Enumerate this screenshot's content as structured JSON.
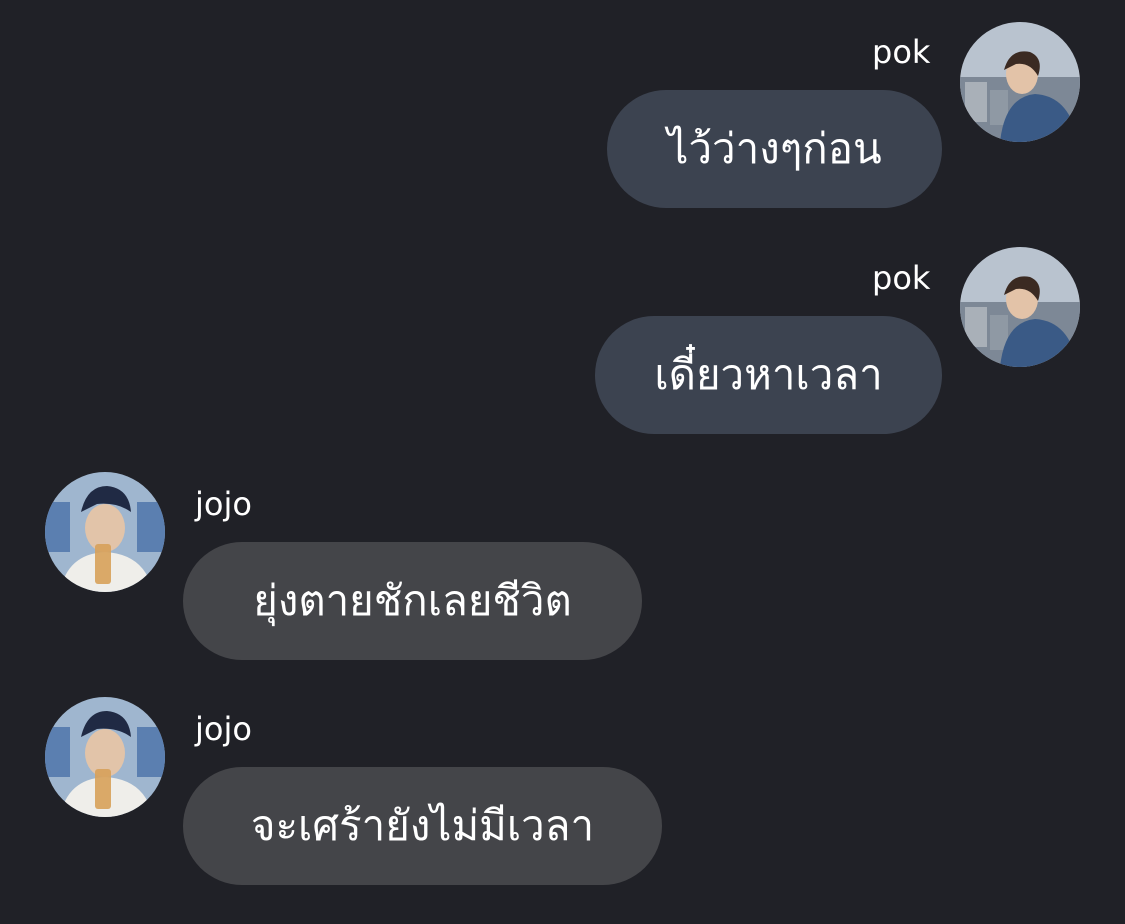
{
  "messages": [
    {
      "sender": "pok",
      "text": "ไว้ว่างๆก่อน",
      "direction": "outgoing",
      "avatar": "user-photo"
    },
    {
      "sender": "pok",
      "text": "เดี๋ยวหาเวลา",
      "direction": "outgoing",
      "avatar": "user-photo"
    },
    {
      "sender": "jojo",
      "text": "ยุ่งตายชักเลยชีวิต",
      "direction": "incoming",
      "avatar": "user-photo"
    },
    {
      "sender": "jojo",
      "text": "จะเศร้ายังไม่มีเวลา",
      "direction": "incoming",
      "avatar": "user-photo"
    }
  ],
  "colors": {
    "background": "#202127",
    "outgoing_bubble": "#3c4350",
    "incoming_bubble": "#444549",
    "text": "#ffffff"
  }
}
